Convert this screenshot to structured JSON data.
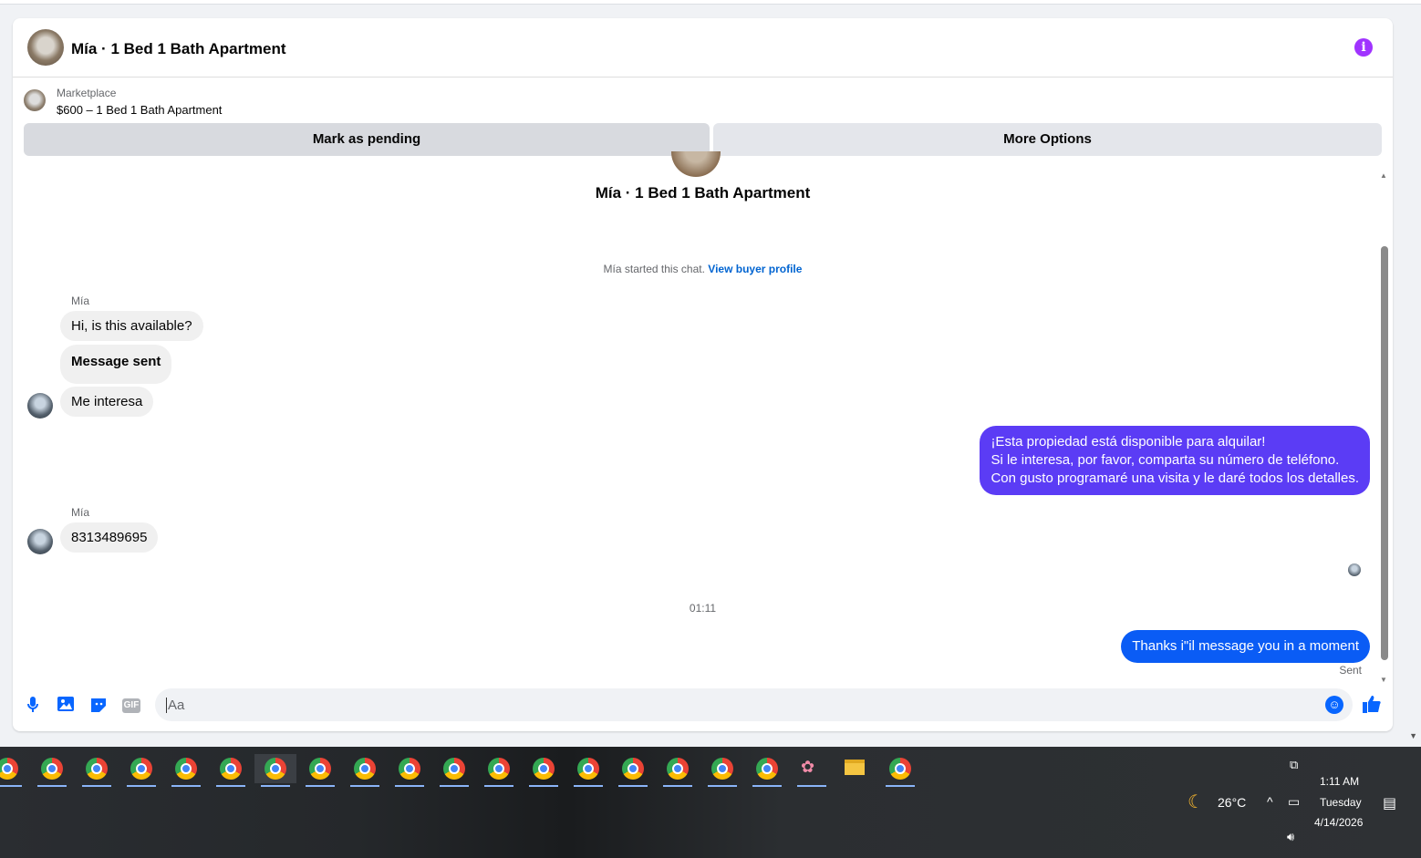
{
  "header": {
    "title": "Mía · 1 Bed 1 Bath Apartment"
  },
  "listing": {
    "category": "Marketplace",
    "price_title": "$600 – 1 Bed 1 Bath Apartment"
  },
  "actions": {
    "pending_label": "Mark as pending",
    "more_label": "More Options"
  },
  "chat": {
    "title": "Mía · 1 Bed 1 Bath Apartment",
    "started_text": "Mía started this chat.",
    "buyer_link": "View buyer profile",
    "messages": [
      {
        "sender": "Mía",
        "text": "Hi, is this available?"
      },
      {
        "text": "Message sent"
      },
      {
        "text": "Me interesa"
      },
      {
        "outgoing": true,
        "lines": [
          "¡Esta propiedad está disponible para alquilar!",
          "Si le interesa, por favor, comparta su número de teléfono.",
          "Con gusto programaré una visita y le daré todos los detalles."
        ]
      },
      {
        "sender": "Mía",
        "text": "8313489695"
      },
      {
        "outgoing": true,
        "text": "Thanks i\"il message you in a moment"
      }
    ],
    "timestamp": "01:11",
    "sent_status": "Sent"
  },
  "composer": {
    "placeholder": "Aa",
    "gif_label": "GIF"
  },
  "taskbar": {
    "weather_temp": "26°C",
    "time": "1:11 AM",
    "day": "Tuesday",
    "date": "4/14/2026"
  },
  "colors": {
    "accent": "#0866ff",
    "outgoing_purple": "#5b3cf5",
    "outgoing_blue": "#0a5cf5",
    "info": "#a033ff"
  }
}
